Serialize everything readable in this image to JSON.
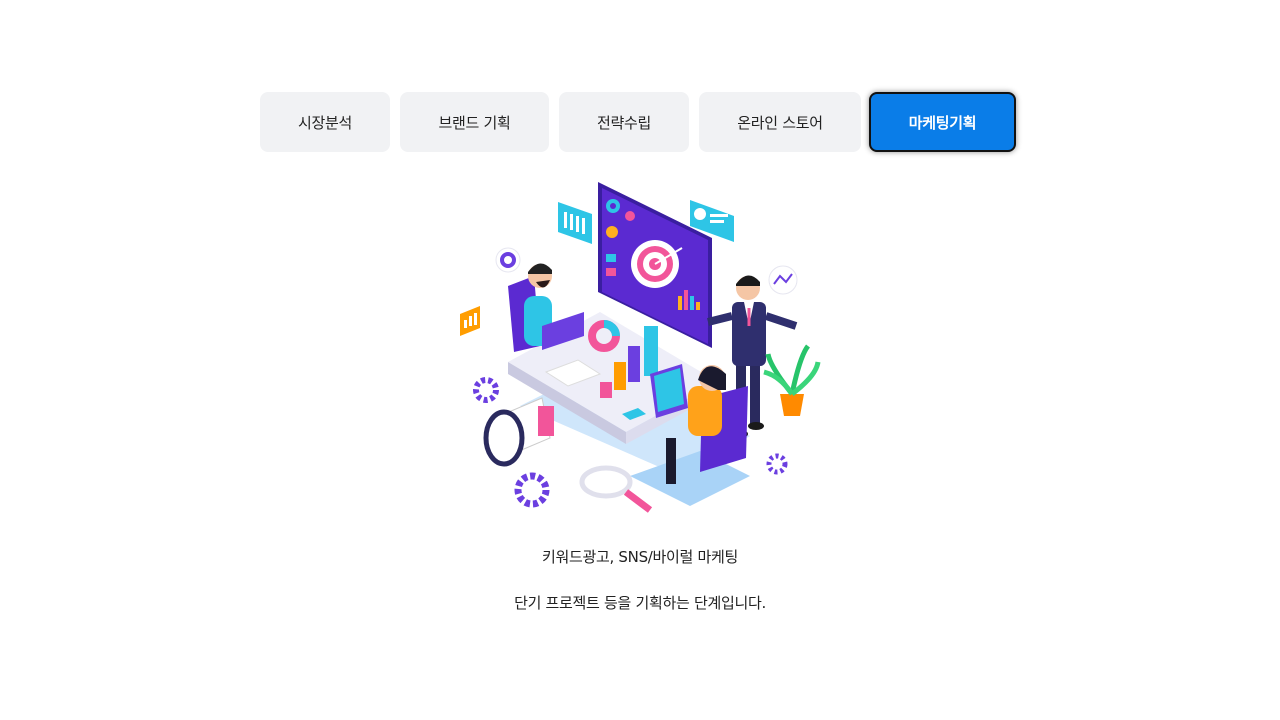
{
  "tabs": [
    {
      "label": "시장분석",
      "active": false
    },
    {
      "label": "브랜드 기획",
      "active": false
    },
    {
      "label": "전략수립",
      "active": false
    },
    {
      "label": "온라인 스토어",
      "active": false
    },
    {
      "label": "마케팅기획",
      "active": true
    }
  ],
  "content": {
    "line1": "키워드광고, SNS/바이럴 마케팅",
    "line2": "단기 프로젝트 등을 기획하는 단계입니다."
  },
  "colors": {
    "active_tab": "#0a7de8",
    "inactive_tab": "#f1f2f4",
    "illustration_purple": "#5b2ad1",
    "illustration_cyan": "#2ec5e6"
  }
}
